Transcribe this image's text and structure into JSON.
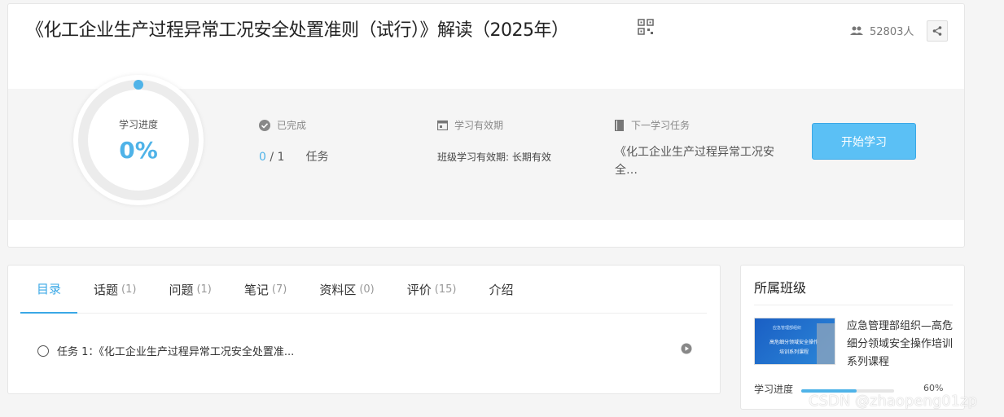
{
  "course": {
    "title": "《化工企业生产过程异常工况安全处置准则（试行）》解读（2025年）",
    "students": "52803人"
  },
  "progress": {
    "label": "学习进度",
    "value_text": "0%",
    "value": 0,
    "completed_label": "已完成",
    "completed_num": "0",
    "completed_sep": " / 1",
    "completed_unit": "任务",
    "valid_label": "学习有效期",
    "valid_text": "班级学习有效期: 长期有效",
    "next_label": "下一学习任务",
    "next_text": "《化工企业生产过程异常工况安全…",
    "start_button": "开始学习"
  },
  "tabs": [
    {
      "label": "目录",
      "count": ""
    },
    {
      "label": "话题",
      "count": "(1)"
    },
    {
      "label": "问题",
      "count": "(1)"
    },
    {
      "label": "笔记",
      "count": "(7)"
    },
    {
      "label": "资料区",
      "count": "(0)"
    },
    {
      "label": "评价",
      "count": "(15)"
    },
    {
      "label": "介绍",
      "count": ""
    }
  ],
  "task": {
    "text": "任务 1：《化工企业生产过程异常工况安全处置准..."
  },
  "side": {
    "title": "所属班级",
    "class_name": "应急管理部组织—高危细分领域安全操作培训系列课程",
    "thumb_line1": "应急管理部组织",
    "thumb_line2": "高危细分领域安全操作",
    "thumb_line3": "培训系列课程",
    "progress_label": "学习进度",
    "progress_text": "60%",
    "progress_value": 0.6
  },
  "watermark": "CSDN @zhaopeng01zp",
  "colors": {
    "accent": "#4fb3e8",
    "button": "#5bc0f5"
  }
}
